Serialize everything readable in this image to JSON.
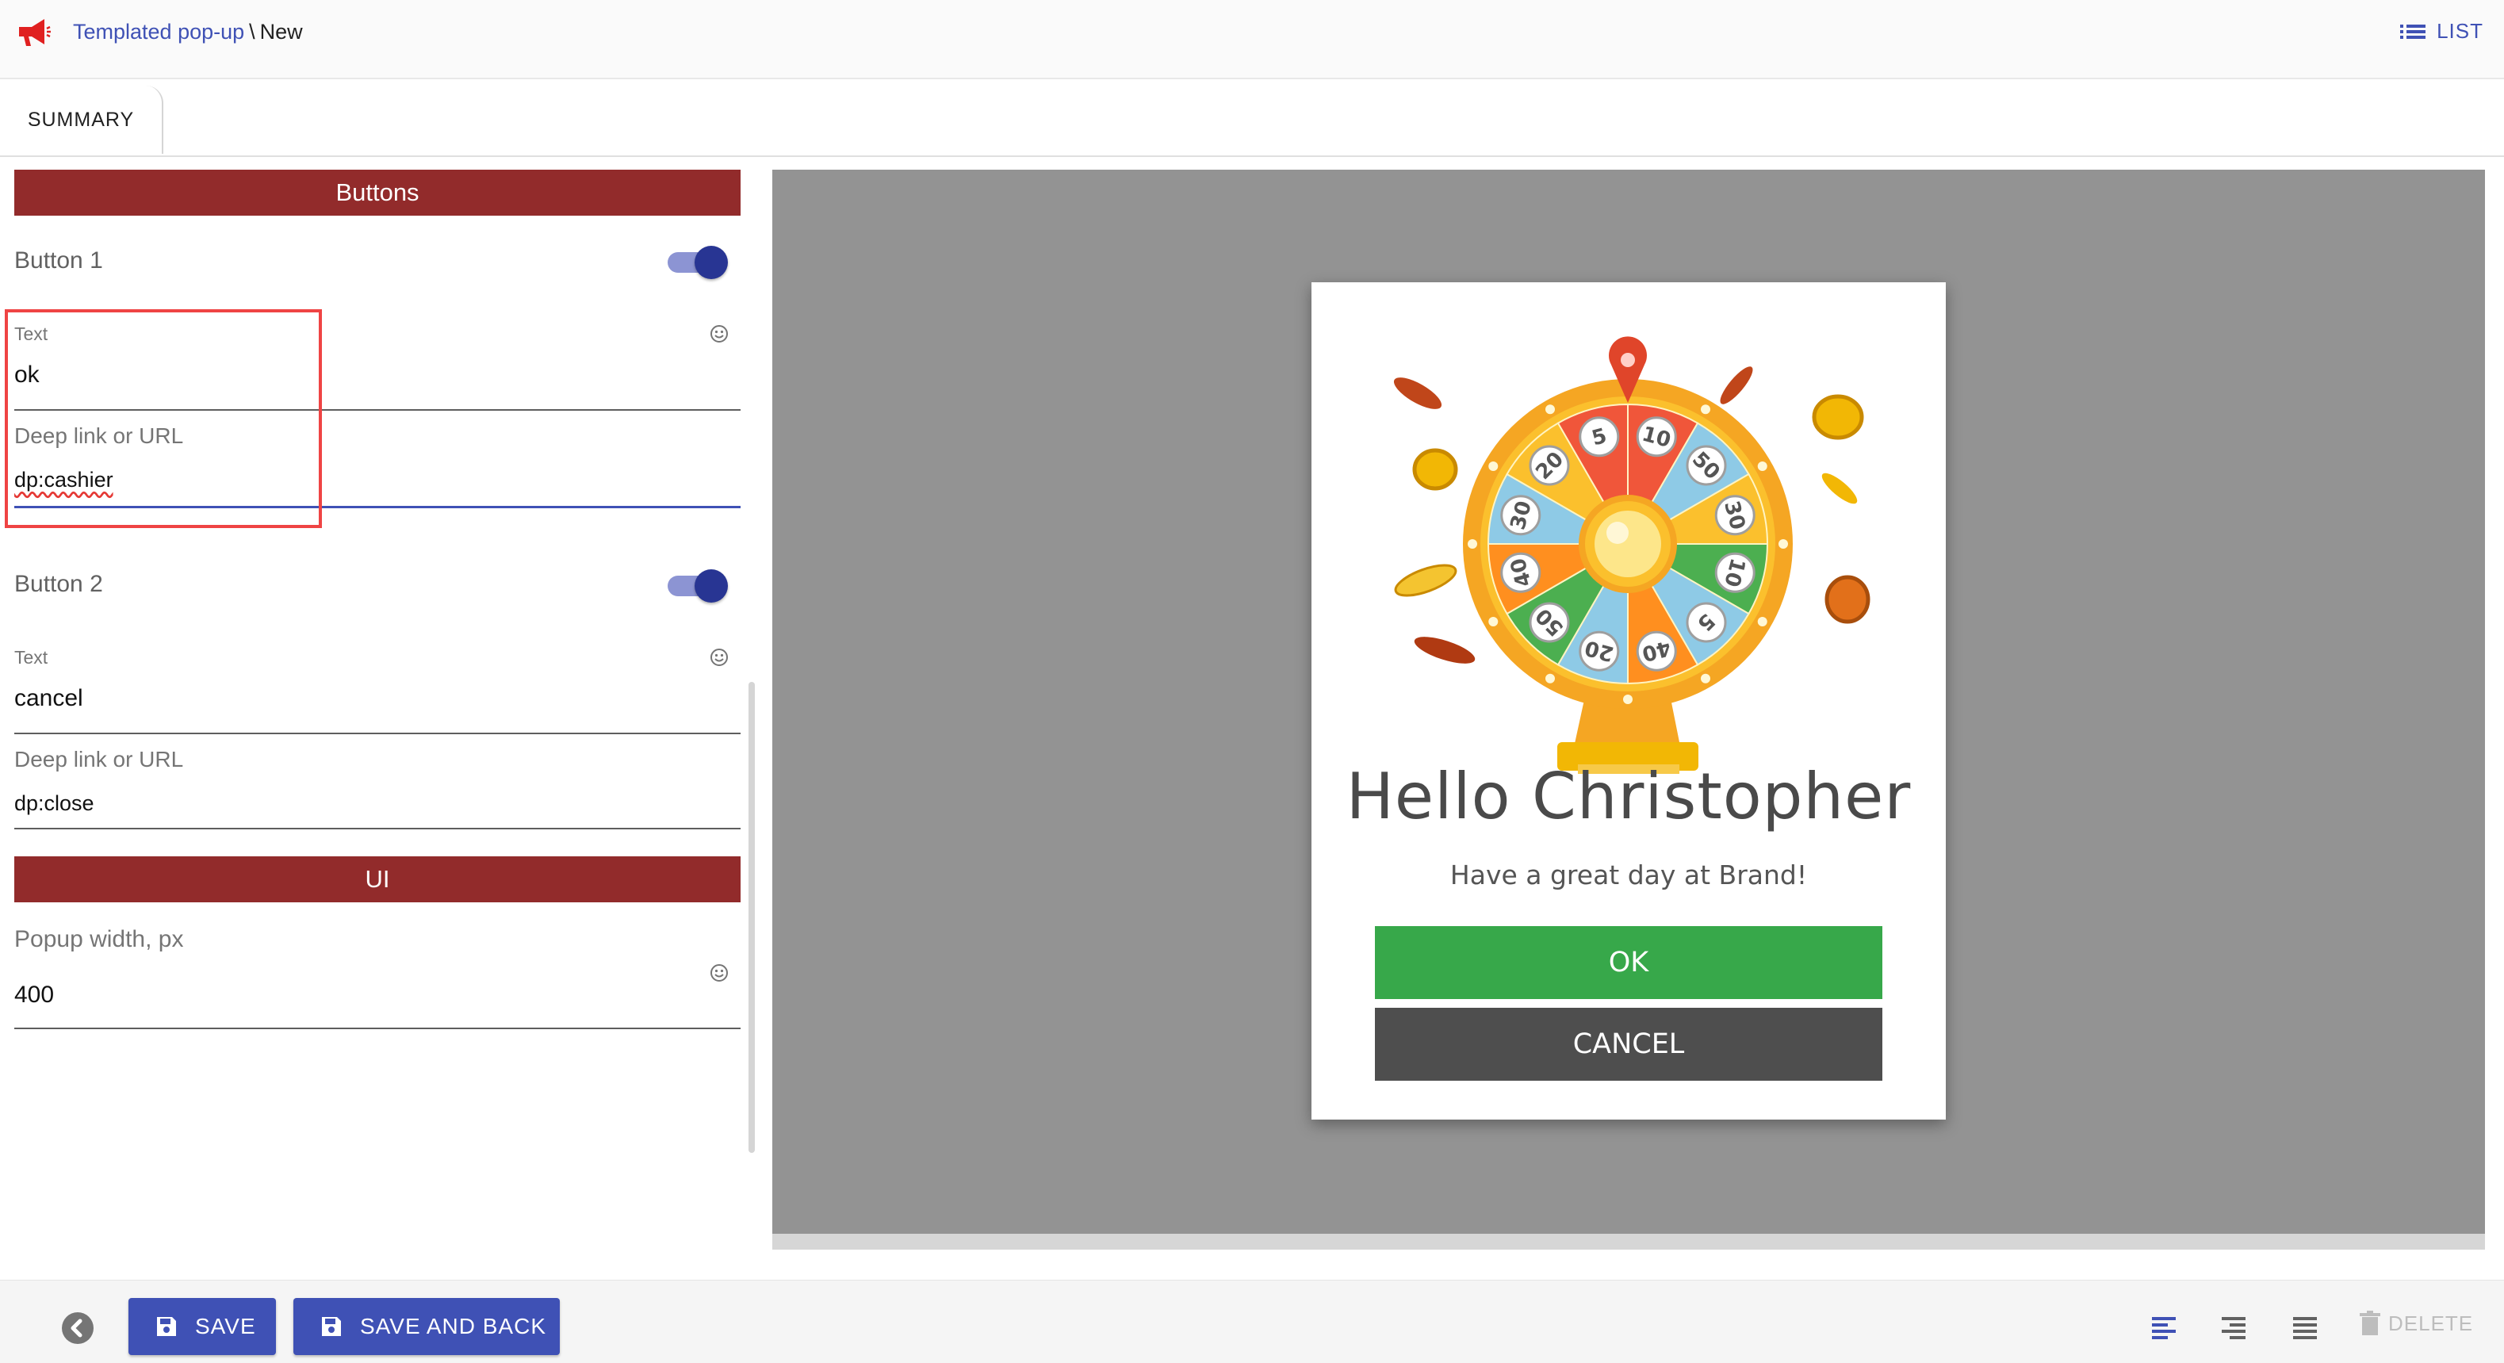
{
  "header": {
    "breadcrumb_link": "Templated pop-up",
    "breadcrumb_separator": "\\",
    "breadcrumb_current": "New",
    "list_label": "LIST"
  },
  "tabs": [
    {
      "label": "SUMMARY"
    }
  ],
  "form": {
    "buttons_section": "Buttons",
    "button1": {
      "label": "Button 1",
      "enabled": true,
      "text_label": "Text",
      "text_value": "ok",
      "url_label": "Deep link or URL",
      "url_value": "dp:cashier"
    },
    "button2": {
      "label": "Button 2",
      "enabled": true,
      "text_label": "Text",
      "text_value": "cancel",
      "url_label": "Deep link or URL",
      "url_value": "dp:close"
    },
    "ui_section": "UI",
    "popup_width_label": "Popup width, px",
    "popup_width_value": "400"
  },
  "preview": {
    "title": "Hello Christopher",
    "subtitle": "Have a great day at Brand!",
    "ok_label": "OK",
    "cancel_label": "CANCEL",
    "wheel_numbers": [
      "10",
      "50",
      "30",
      "10",
      "5",
      "40",
      "20",
      "50",
      "40",
      "30",
      "20",
      "5"
    ]
  },
  "footer": {
    "save_label": "SAVE",
    "save_back_label": "SAVE AND BACK",
    "delete_label": "DELETE"
  },
  "colors": {
    "primary": "#3f51b5",
    "section_header": "#922b2b",
    "ok_button": "#37a84a",
    "cancel_button": "#4e4e4e",
    "highlight": "#ef4444"
  }
}
